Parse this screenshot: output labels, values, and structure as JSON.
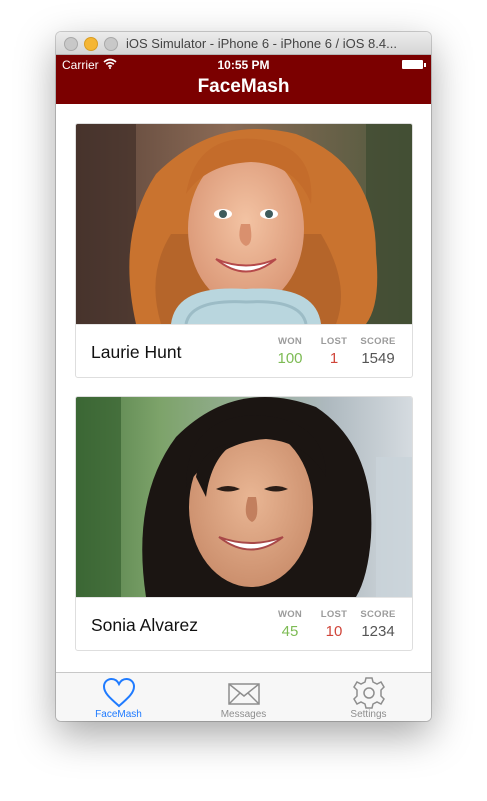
{
  "window": {
    "title": "iOS Simulator - iPhone 6 - iPhone 6 / iOS 8.4..."
  },
  "status_bar": {
    "carrier": "Carrier",
    "time": "10:55 PM"
  },
  "app": {
    "title": "FaceMash",
    "brand_color": "#7b0000"
  },
  "cards": [
    {
      "name": "Laurie Hunt",
      "won_label": "WON",
      "won": "100",
      "lost_label": "LOST",
      "lost": "1",
      "score_label": "SCORE",
      "score": "1549"
    },
    {
      "name": "Sonia Alvarez",
      "won_label": "WON",
      "won": "45",
      "lost_label": "LOST",
      "lost": "10",
      "score_label": "SCORE",
      "score": "1234"
    }
  ],
  "colors": {
    "won": "#7dbb54",
    "lost": "#d0453a",
    "score": "#555555",
    "tab_active": "#1f7bff",
    "tab_inactive": "#8e8e8e"
  },
  "tabs": [
    {
      "label": "FaceMash",
      "icon": "heart-icon",
      "active": true
    },
    {
      "label": "Messages",
      "icon": "envelope-icon",
      "active": false
    },
    {
      "label": "Settings",
      "icon": "gear-icon",
      "active": false
    }
  ]
}
